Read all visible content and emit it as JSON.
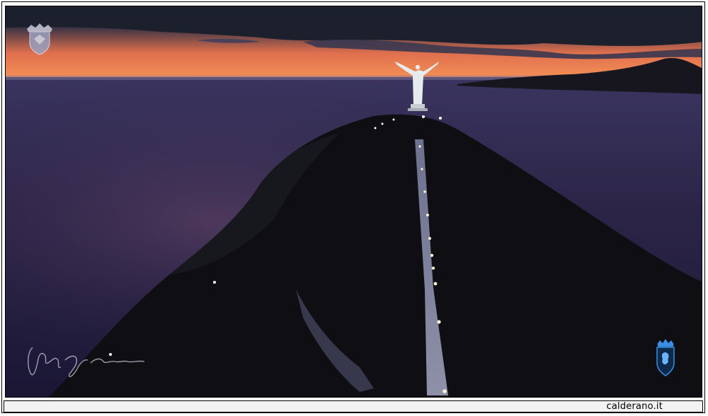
{
  "scene": {
    "watermark_crest_icon": "crest-icon",
    "signature_icon": "signature-icon",
    "logo_icon": "lion-shield-icon",
    "colors": {
      "sky_glow": "#f07a4a",
      "sky_dark": "#2a2a3a",
      "sea": "#2b2346",
      "mountain": "#0f0f14",
      "statue": "#e8eef0",
      "path_light": "#cfd3ea"
    }
  },
  "footer": {
    "site_label": "calderano.it"
  }
}
